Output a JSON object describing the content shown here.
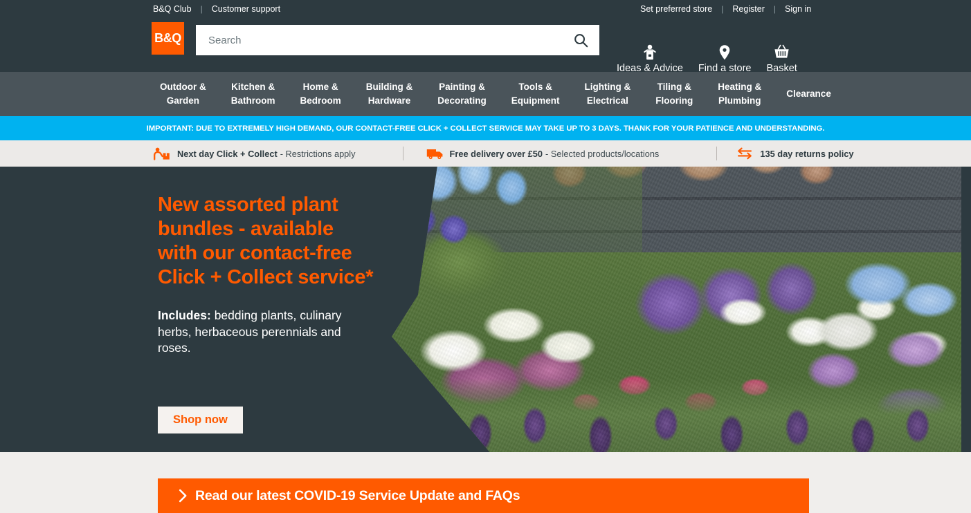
{
  "colors": {
    "brand_orange": "#ff5a00",
    "header_slate": "#2d3a40",
    "nav_slate": "#4a545a",
    "alert_blue": "#00b2f0",
    "usp_grey": "#eceae8",
    "page_bg": "#f0eeec"
  },
  "utility": {
    "left_links": [
      "B&Q Club",
      "Customer support"
    ],
    "right_links": [
      "Set preferred store",
      "Register",
      "Sign in"
    ],
    "separator": "|"
  },
  "header": {
    "logo_text": "B&Q",
    "search": {
      "placeholder": "Search",
      "value": "",
      "button_icon": "search-icon"
    },
    "actions": [
      {
        "label": "Ideas & Advice",
        "icon": "advice-person-icon"
      },
      {
        "label": "Find a store",
        "icon": "map-pin-icon"
      },
      {
        "label": "Basket",
        "icon": "basket-icon"
      }
    ]
  },
  "nav": {
    "items": [
      "Outdoor &\nGarden",
      "Kitchen &\nBathroom",
      "Home &\nBedroom",
      "Building &\nHardware",
      "Painting &\nDecorating",
      "Tools &\nEquipment",
      "Lighting &\nElectrical",
      "Tiling &\nFlooring",
      "Heating &\nPlumbing",
      "Clearance"
    ]
  },
  "alert": {
    "text": "IMPORTANT: DUE TO EXTREMELY HIGH DEMAND, OUR CONTACT-FREE CLICK + COLLECT SERVICE MAY TAKE UP TO 3 DAYS. THANK FOR YOUR PATIENCE AND UNDERSTANDING."
  },
  "usp": {
    "items": [
      {
        "icon": "click-collect-icon",
        "strong": "Next day Click + Collect",
        "light": "- Restrictions apply"
      },
      {
        "icon": "delivery-van-icon",
        "strong": "Free delivery over £50",
        "light": "- Selected products/locations"
      },
      {
        "icon": "returns-arrows-icon",
        "strong": "135 day returns policy",
        "light": ""
      }
    ]
  },
  "hero": {
    "title": "New assorted plant\nbundles - available\nwith our contact-free\nClick + Collect service*",
    "subtitle_label": "Includes:",
    "subtitle_text": " bedding plants, culinary herbs, herbaceous perennials and roses.",
    "cta_label": "Shop now",
    "image_alt": "garden-border-flowers-photo"
  },
  "covid_cta": {
    "icon": "chevron-right-icon",
    "label": "Read our latest COVID-19 Service Update and FAQs"
  }
}
